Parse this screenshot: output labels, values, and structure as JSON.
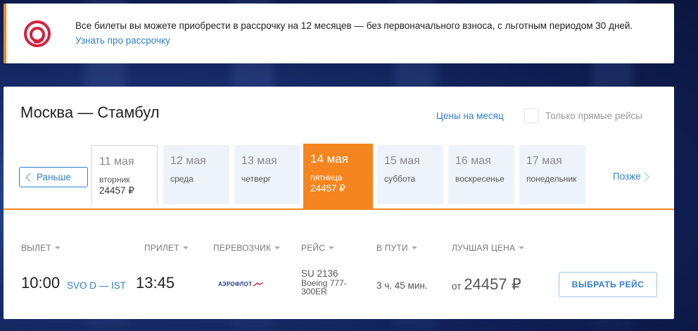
{
  "banner": {
    "text": "Все билеты вы можете приобрести в рассрочку на 12 месяцев — без первоначального взноса, с льготным периодом 30 дней.",
    "link": "Узнать про рассрочку",
    "logo_icon": "spiral-logo-icon"
  },
  "route": {
    "title": "Москва — Стамбул",
    "month_prices": "Цены на месяц",
    "direct_only": "Только прямые рейсы"
  },
  "nav": {
    "earlier": "Раньше",
    "later": "Позже"
  },
  "days": [
    {
      "date": "11 мая",
      "dow": "вторник",
      "price": "24457 ₽"
    },
    {
      "date": "12 мая",
      "dow": "среда",
      "price": ""
    },
    {
      "date": "13 мая",
      "dow": "четверг",
      "price": ""
    },
    {
      "date": "14 мая",
      "dow": "пятница",
      "price": "24457 ₽"
    },
    {
      "date": "15 мая",
      "dow": "суббота",
      "price": ""
    },
    {
      "date": "16 мая",
      "dow": "воскресенье",
      "price": ""
    },
    {
      "date": "17 мая",
      "dow": "понедельник",
      "price": ""
    }
  ],
  "columns": {
    "departure": "ВЫЛЕТ",
    "arrival": "ПРИЛЕТ",
    "carrier": "ПЕРЕВОЗЧИК",
    "flight": "РЕЙС",
    "duration": "В ПУТИ",
    "best_price": "ЛУЧШАЯ ЦЕНА"
  },
  "flight_row": {
    "dep_time": "10:00",
    "airports": "SVO D — IST",
    "arr_time": "13:45",
    "carrier_name": "АЭРОФЛОТ",
    "flight_number": "SU 2136",
    "aircraft_line1": "Boeing 777-",
    "aircraft_line2": "300ER",
    "duration": "3 ч. 45 мин.",
    "price_prefix": "от",
    "price": "24457 ₽",
    "select_button": "ВЫБРАТЬ РЕЙС"
  },
  "colors": {
    "accent": "#f5861f",
    "link": "#2f7fd4",
    "day_bg": "#eef3fa"
  }
}
